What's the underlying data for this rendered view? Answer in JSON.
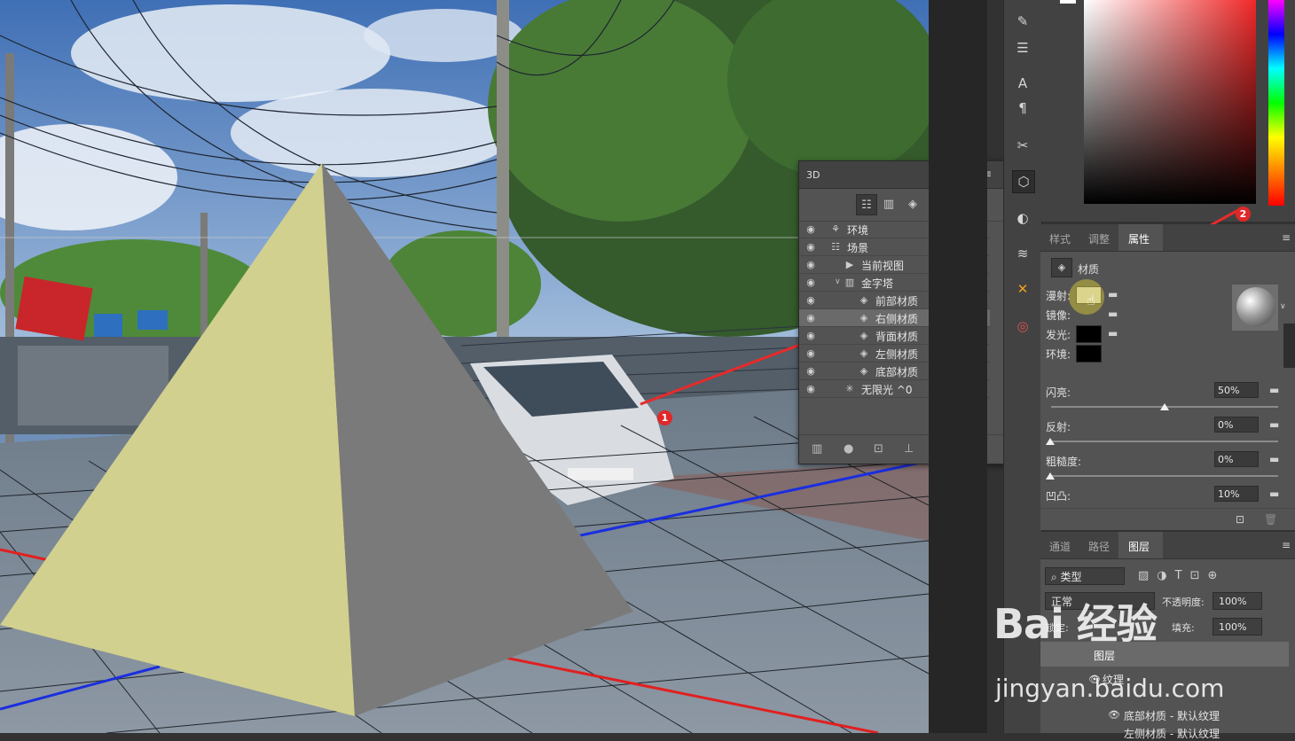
{
  "panel3d": {
    "tab": "3D",
    "controls": "» ≡",
    "filter_icons": [
      "scene-filter-icon",
      "mesh-filter-icon",
      "material-filter-icon",
      "light-filter-icon"
    ],
    "tree": [
      {
        "label": "环境",
        "icon": "environment-icon",
        "indent": 0,
        "expander": ""
      },
      {
        "label": "场景",
        "icon": "scene-icon",
        "indent": 0,
        "expander": ""
      },
      {
        "label": "当前视图",
        "icon": "camera-icon",
        "indent": 1,
        "expander": ""
      },
      {
        "label": "金字塔",
        "icon": "mesh-icon",
        "indent": 1,
        "expander": "∨"
      },
      {
        "label": "前部材质",
        "icon": "material-icon",
        "indent": 2,
        "expander": ""
      },
      {
        "label": "右侧材质",
        "icon": "material-icon",
        "indent": 2,
        "expander": "",
        "selected": true
      },
      {
        "label": "背面材质",
        "icon": "material-icon",
        "indent": 2,
        "expander": ""
      },
      {
        "label": "左侧材质",
        "icon": "material-icon",
        "indent": 2,
        "expander": ""
      },
      {
        "label": "底部材质",
        "icon": "material-icon",
        "indent": 2,
        "expander": ""
      },
      {
        "label": "无限光 ^0",
        "icon": "infinite-light-icon",
        "indent": 1,
        "expander": ""
      }
    ]
  },
  "annotations": {
    "marker1": "1",
    "marker2": "2",
    "color": "#e02828"
  },
  "properties": {
    "tabs": [
      "样式",
      "调整",
      "属性"
    ],
    "active_tab": "属性",
    "section_title": "材质",
    "diffuse_label": "漫射:",
    "specular_label": "镜像:",
    "illumination_label": "发光:",
    "ambient_label": "环境:",
    "shine_label": "闪亮:",
    "shine_value": "50%",
    "reflection_label": "反射:",
    "reflection_value": "0%",
    "roughness_label": "粗糙度:",
    "roughness_value": "0%",
    "bump_label": "凹凸:",
    "bump_value": "10%",
    "colors": {
      "diffuse": "#f0f0f0",
      "illumination": "#000000",
      "ambient": "#000000"
    }
  },
  "layers": {
    "tabs": [
      "通道",
      "路径",
      "图层"
    ],
    "active_tab": "图层",
    "filter_label": "类型",
    "blend_mode": "正常",
    "opacity_label": "不透明度:",
    "opacity_value": "100%",
    "lock_label": "锁定:",
    "fill_label": "填充:",
    "fill_value": "100%",
    "layer_name": "图层",
    "texture_label": "纹理",
    "sub1": "底部材质 - 默认纹理",
    "sub2": "左侧材质 - 默认纹理"
  },
  "watermark": {
    "main": "Bai 经验",
    "sub": "jingyan.baidu.com"
  }
}
